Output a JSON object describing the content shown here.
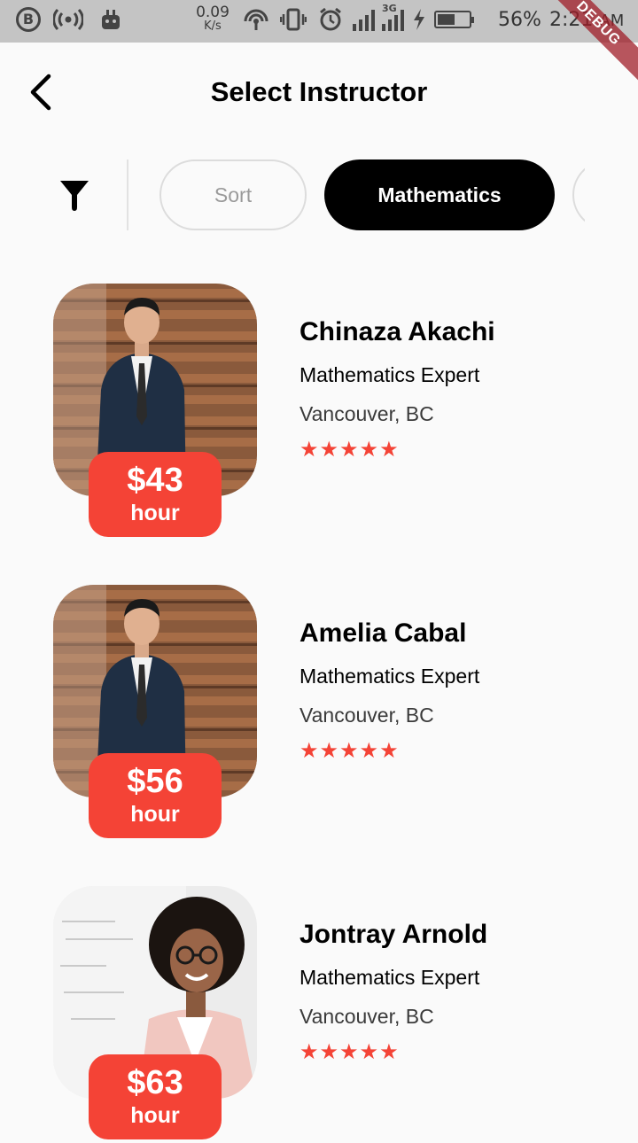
{
  "status_bar": {
    "speed_value": "0.09",
    "speed_unit": "K/s",
    "network_type": "3G",
    "battery_percent": "56%",
    "battery_level": 0.56,
    "time": "2:21",
    "ampm": "AM",
    "debug_label": "DEBUG"
  },
  "header": {
    "title": "Select Instructor"
  },
  "filters": {
    "chips": [
      {
        "label": "Sort",
        "selected": false
      },
      {
        "label": "Mathematics",
        "selected": true
      },
      {
        "label": "",
        "selected": false
      }
    ]
  },
  "instructors": [
    {
      "name": "Chinaza Akachi",
      "specialty": "Mathematics Expert",
      "location": "Vancouver, BC",
      "rating": 5,
      "stars": "★★★★★",
      "price": "$43",
      "price_unit": "hour"
    },
    {
      "name": "Amelia Cabal",
      "specialty": "Mathematics Expert",
      "location": "Vancouver, BC",
      "rating": 5,
      "stars": "★★★★★",
      "price": "$56",
      "price_unit": "hour"
    },
    {
      "name": "Jontray Arnold",
      "specialty": "Mathematics Expert",
      "location": "Vancouver, BC",
      "rating": 5,
      "stars": "★★★★★",
      "price": "$63",
      "price_unit": "hour"
    }
  ],
  "colors": {
    "accent": "#f44336",
    "chip_selected_bg": "#000000",
    "background": "#fafafa"
  }
}
